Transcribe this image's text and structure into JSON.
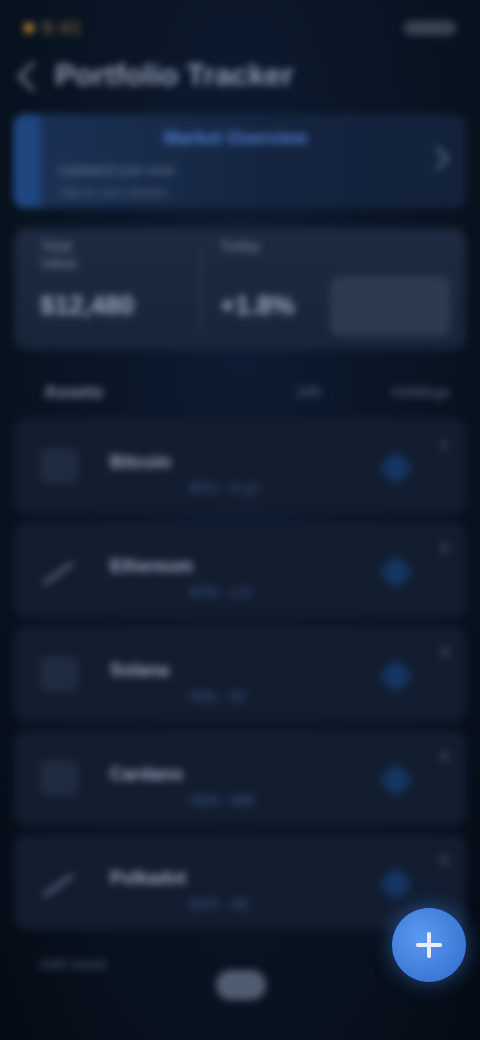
{
  "status": {
    "time": "9:41"
  },
  "header": {
    "title": "Portfolio Tracker"
  },
  "info": {
    "title": "Market Overview",
    "sub": "Updated just now",
    "sub2": "Tap to see details"
  },
  "stats": {
    "left_label": "Total Value",
    "left_value": "$12,480",
    "mid_label": "Today",
    "mid_value": "+1.8%"
  },
  "list_header": {
    "left": "Assets",
    "mid": "24h",
    "right": "Holdings"
  },
  "rows": [
    {
      "name": "Bitcoin",
      "sub": "BTC · 0.12",
      "count": "1"
    },
    {
      "name": "Ethereum",
      "sub": "ETH · 1.5",
      "count": "2"
    },
    {
      "name": "Solana",
      "sub": "SOL · 22",
      "count": "3"
    },
    {
      "name": "Cardano",
      "sub": "ADA · 900",
      "count": "4"
    },
    {
      "name": "Polkadot",
      "sub": "DOT · 45",
      "count": "5"
    }
  ],
  "bottom": {
    "label": "Add asset"
  },
  "colors": {
    "accent": "#3c78d6",
    "bg": "#08121f"
  }
}
